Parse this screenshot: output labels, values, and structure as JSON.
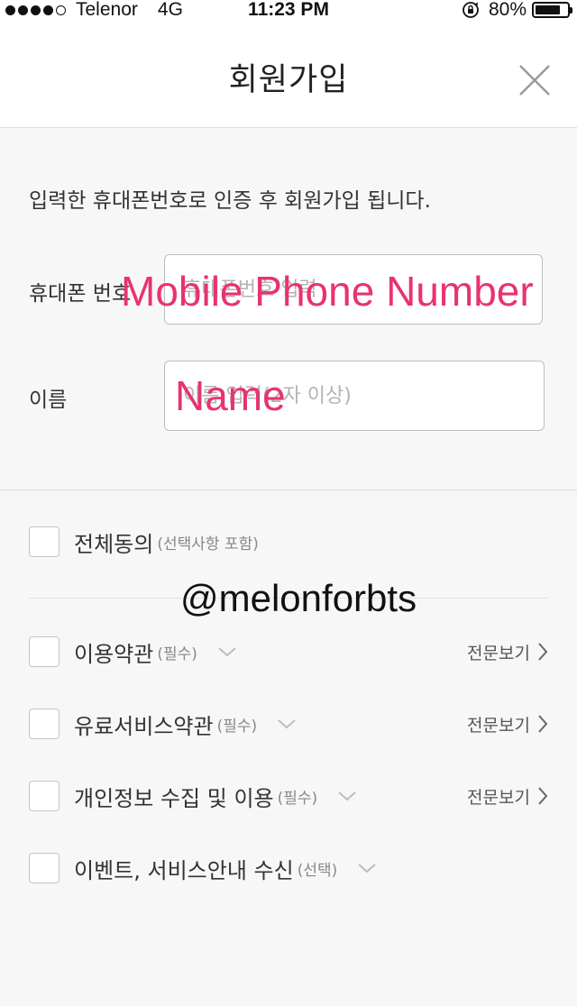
{
  "status_bar": {
    "carrier": "Telenor",
    "network": "4G",
    "time": "11:23 PM",
    "battery_percent": "80%",
    "battery_level": 0.8,
    "signal_bars": 4,
    "signal_total": 5
  },
  "header": {
    "title": "회원가입",
    "close_icon": "close-icon"
  },
  "intro_text": "입력한 휴대폰번호로 인증 후 회원가입 됩니다.",
  "form": {
    "phone": {
      "label": "휴대폰 번호",
      "placeholder": "휴대폰번호 입력",
      "value": ""
    },
    "name": {
      "label": "이름",
      "placeholder": "이름 입력(2자 이상)",
      "value": ""
    }
  },
  "overlay": {
    "phone_caption": "Mobile Phone Number",
    "name_caption": "Name",
    "watermark": "@melonforbts",
    "color": "#e8336f"
  },
  "agreements": {
    "all": {
      "label": "전체동의",
      "note": "(선택사항 포함)"
    },
    "items": [
      {
        "label": "이용약관",
        "note": "(필수)",
        "view": "전문보기"
      },
      {
        "label": "유료서비스약관",
        "note": "(필수)",
        "view": "전문보기"
      },
      {
        "label": "개인정보 수집 및 이용",
        "note": "(필수)",
        "view": "전문보기"
      },
      {
        "label": "이벤트, 서비스안내 수신",
        "note": "(선택)"
      }
    ]
  }
}
